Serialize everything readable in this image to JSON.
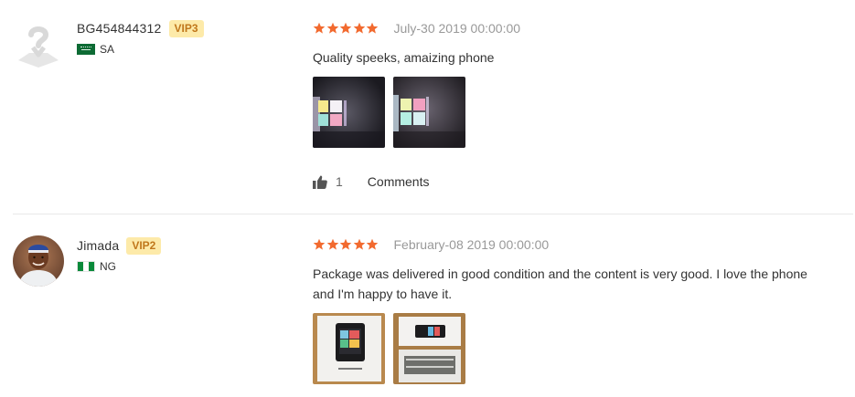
{
  "reviews": [
    {
      "username": "BG454844312",
      "vip": "VIP3",
      "country": "SA",
      "rating": 5,
      "date": "July-30 2019 00:00:00",
      "text": "Quality speeks, amaizing phone",
      "likes": "1",
      "comments_label": "Comments"
    },
    {
      "username": "Jimada",
      "vip": "VIP2",
      "country": "NG",
      "rating": 5,
      "date": "February-08 2019 00:00:00",
      "text": "Package was delivered in good condition and the content is very good. I love the phone and I'm happy to have it."
    }
  ],
  "colors": {
    "star": "#f26a2f",
    "vip_bg": "#fdeaa9",
    "vip_text": "#c0771b",
    "date": "#999999"
  },
  "icons": {
    "default_avatar": "user-placeholder-icon",
    "star": "star-icon",
    "like": "thumbs-up-icon"
  }
}
